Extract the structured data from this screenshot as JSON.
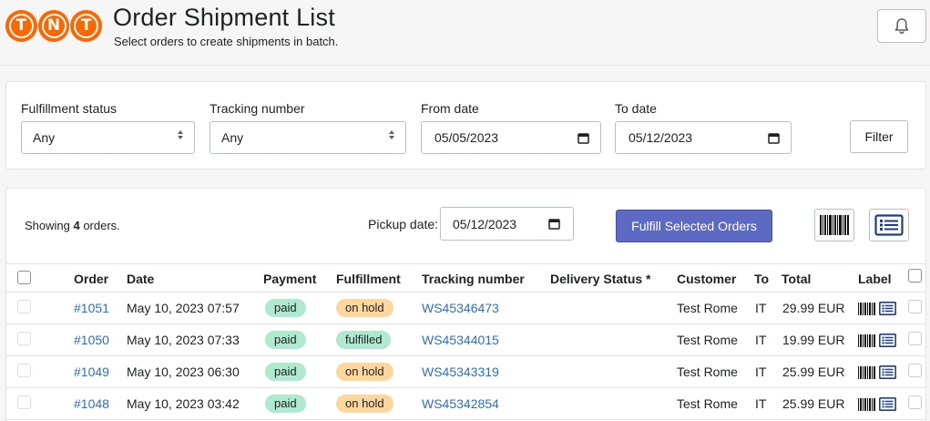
{
  "header": {
    "logo_text": "TNT",
    "logo_letters": [
      "T",
      "N",
      "T"
    ],
    "title": "Order Shipment List",
    "subtitle": "Select orders to create shipments in batch."
  },
  "filters": {
    "fulfillment_status": {
      "label": "Fulfillment status",
      "value": "Any"
    },
    "tracking_number": {
      "label": "Tracking number",
      "value": "Any"
    },
    "from_date": {
      "label": "From date",
      "value": "05/05/2023"
    },
    "to_date": {
      "label": "To date",
      "value": "05/12/2023"
    },
    "filter_button": "Filter"
  },
  "toolbar": {
    "showing_prefix": "Showing ",
    "showing_count": "4",
    "showing_suffix": " orders.",
    "pickup_label": "Pickup date:",
    "pickup_value": "05/12/2023",
    "fulfill_button": "Fulfill Selected Orders"
  },
  "table": {
    "headers": [
      "Order",
      "Date",
      "Payment",
      "Fulfillment",
      "Tracking number",
      "Delivery Status *",
      "Customer",
      "To",
      "Total",
      "Label"
    ],
    "rows": [
      {
        "order": "#1051",
        "date": "May 10, 2023 07:57",
        "payment": "paid",
        "fulfillment": "on hold",
        "tracking": "WS45346473",
        "delivery": "",
        "customer": "Test Rome",
        "to": "IT",
        "total": "29.99 EUR"
      },
      {
        "order": "#1050",
        "date": "May 10, 2023 07:33",
        "payment": "paid",
        "fulfillment": "fulfilled",
        "tracking": "WS45344015",
        "delivery": "",
        "customer": "Test Rome",
        "to": "IT",
        "total": "19.99 EUR"
      },
      {
        "order": "#1049",
        "date": "May 10, 2023 06:30",
        "payment": "paid",
        "fulfillment": "on hold",
        "tracking": "WS45343319",
        "delivery": "",
        "customer": "Test Rome",
        "to": "IT",
        "total": "25.99 EUR"
      },
      {
        "order": "#1048",
        "date": "May 10, 2023 03:42",
        "payment": "paid",
        "fulfillment": "on hold",
        "tracking": "WS45342854",
        "delivery": "",
        "customer": "Test Rome",
        "to": "IT",
        "total": "25.99 EUR"
      }
    ]
  },
  "icons": {
    "bell": "bell-icon",
    "barcode": "barcode-icon",
    "list": "list-icon",
    "calendar": "calendar-icon",
    "select_arrows": "chevron-up-down-icon"
  },
  "colors": {
    "brand_orange": "#ff6600",
    "primary_button": "#5c6ac4",
    "link": "#2c6ecb",
    "badge_paid": "#aee9d1",
    "badge_on_hold": "#ffd79d",
    "badge_fulfilled": "#aee9d1",
    "list_icon": "#1f3c88"
  }
}
